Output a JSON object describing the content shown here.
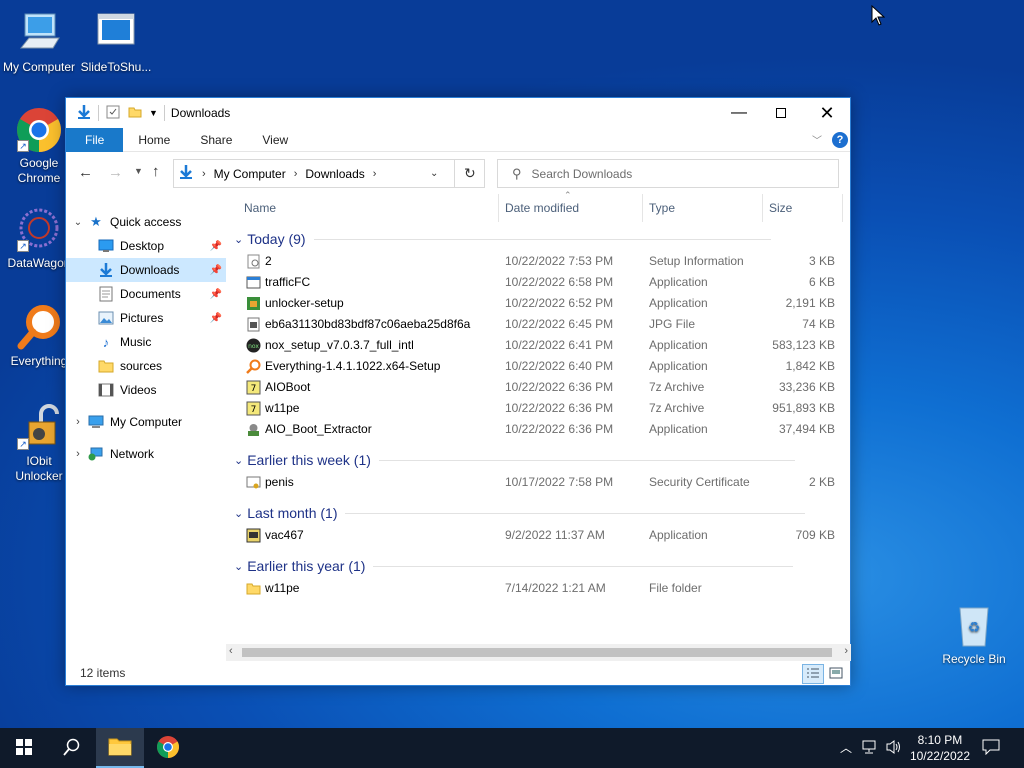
{
  "desktop": {
    "icons": [
      {
        "label": "My Computer"
      },
      {
        "label": "SlideToShu..."
      },
      {
        "label": "Google Chrome"
      },
      {
        "label": "DataWagon"
      },
      {
        "label": "Everything"
      },
      {
        "label": "IObit Unlocker"
      },
      {
        "label": "Recycle Bin"
      }
    ]
  },
  "window": {
    "title": "Downloads",
    "ribbon_tabs": [
      "File",
      "Home",
      "Share",
      "View"
    ],
    "address": {
      "segments": [
        "My Computer",
        "Downloads"
      ]
    },
    "search": {
      "placeholder": "Search Downloads"
    },
    "sidebar": [
      {
        "label": "Quick access"
      },
      {
        "label": "Desktop"
      },
      {
        "label": "Downloads"
      },
      {
        "label": "Documents"
      },
      {
        "label": "Pictures"
      },
      {
        "label": "Music"
      },
      {
        "label": "sources"
      },
      {
        "label": "Videos"
      },
      {
        "label": "My Computer"
      },
      {
        "label": "Network"
      }
    ],
    "columns": [
      "Name",
      "Date modified",
      "Type",
      "Size"
    ],
    "groups": [
      {
        "title": "Today (9)",
        "files": [
          {
            "name": "2",
            "date": "10/22/2022 7:53 PM",
            "type": "Setup Information",
            "size": "3 KB"
          },
          {
            "name": "trafficFC",
            "date": "10/22/2022 6:58 PM",
            "type": "Application",
            "size": "6 KB"
          },
          {
            "name": "unlocker-setup",
            "date": "10/22/2022 6:52 PM",
            "type": "Application",
            "size": "2,191 KB"
          },
          {
            "name": "eb6a31130bd83bdf87c06aeba25d8f6a",
            "date": "10/22/2022 6:45 PM",
            "type": "JPG File",
            "size": "74 KB"
          },
          {
            "name": "nox_setup_v7.0.3.7_full_intl",
            "date": "10/22/2022 6:41 PM",
            "type": "Application",
            "size": "583,123 KB"
          },
          {
            "name": "Everything-1.4.1.1022.x64-Setup",
            "date": "10/22/2022 6:40 PM",
            "type": "Application",
            "size": "1,842 KB"
          },
          {
            "name": "AIOBoot",
            "date": "10/22/2022 6:36 PM",
            "type": "7z Archive",
            "size": "33,236 KB"
          },
          {
            "name": "w11pe",
            "date": "10/22/2022 6:36 PM",
            "type": "7z Archive",
            "size": "951,893 KB"
          },
          {
            "name": "AIO_Boot_Extractor",
            "date": "10/22/2022 6:36 PM",
            "type": "Application",
            "size": "37,494 KB"
          }
        ]
      },
      {
        "title": "Earlier this week (1)",
        "files": [
          {
            "name": "penis",
            "date": "10/17/2022 7:58 PM",
            "type": "Security Certificate",
            "size": "2 KB"
          }
        ]
      },
      {
        "title": "Last month (1)",
        "files": [
          {
            "name": "vac467",
            "date": "9/2/2022 11:37 AM",
            "type": "Application",
            "size": "709 KB"
          }
        ]
      },
      {
        "title": "Earlier this year (1)",
        "files": [
          {
            "name": "w11pe",
            "date": "7/14/2022 1:21 AM",
            "type": "File folder",
            "size": ""
          }
        ]
      }
    ],
    "status": "12 items"
  },
  "taskbar": {
    "time": "8:10 PM",
    "date": "10/22/2022"
  },
  "colors": {
    "accent": "#1979ca",
    "selection": "#cce8ff",
    "group_header": "#1e3287"
  }
}
